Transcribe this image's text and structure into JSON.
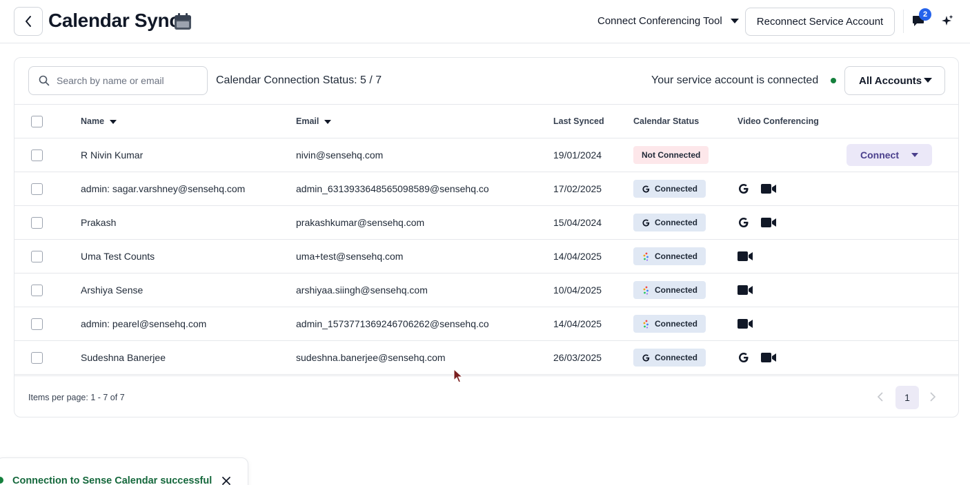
{
  "header": {
    "title": "Calendar Sync",
    "conferencing_tool_label": "Connect Conferencing Tool",
    "reconnect_label": "Reconnect Service Account",
    "notification_count": "2"
  },
  "toolbar": {
    "search_placeholder": "Search by name or email",
    "connection_status": "Calendar Connection Status: 5 / 7",
    "service_account_status": "Your service account is connected",
    "accounts_filter": "All Accounts"
  },
  "table": {
    "columns": {
      "name": "Name",
      "email": "Email",
      "last_synced": "Last Synced",
      "calendar_status": "Calendar Status",
      "video_conferencing": "Video Conferencing"
    },
    "connect_label": "Connect",
    "rows": [
      {
        "name": "R Nivin Kumar",
        "email": "nivin@sensehq.com",
        "last_synced": "19/01/2024",
        "status": "Not Connected",
        "provider": "none",
        "video": []
      },
      {
        "name": "admin: sagar.varshney@sensehq.com",
        "email": "admin_6313933648565098589@sensehq.co",
        "last_synced": "17/02/2025",
        "status": "Connected",
        "provider": "google",
        "video": [
          "google-icon",
          "video-camera-icon"
        ]
      },
      {
        "name": "Prakash",
        "email": "prakashkumar@sensehq.com",
        "last_synced": "15/04/2024",
        "status": "Connected",
        "provider": "google",
        "video": [
          "google-icon",
          "video-camera-icon"
        ]
      },
      {
        "name": "Uma Test Counts",
        "email": "uma+test@sensehq.com",
        "last_synced": "14/04/2025",
        "status": "Connected",
        "provider": "sense",
        "video": [
          "video-camera-icon"
        ]
      },
      {
        "name": "Arshiya Sense",
        "email": "arshiyaa.siingh@sensehq.com",
        "last_synced": "10/04/2025",
        "status": "Connected",
        "provider": "sense",
        "video": [
          "video-camera-icon"
        ]
      },
      {
        "name": "admin: pearel@sensehq.com",
        "email": "admin_1573771369246706262@sensehq.co",
        "last_synced": "14/04/2025",
        "status": "Connected",
        "provider": "sense",
        "video": [
          "video-camera-icon"
        ]
      },
      {
        "name": "Sudeshna Banerjee",
        "email": "sudeshna.banerjee@sensehq.com",
        "last_synced": "26/03/2025",
        "status": "Connected",
        "provider": "google",
        "video": [
          "google-icon",
          "video-camera-icon"
        ]
      }
    ]
  },
  "footer": {
    "items_text": "Items per page: 1 - 7 of 7",
    "current_page": "1"
  },
  "toast": {
    "message": "Connection to Sense Calendar successful"
  },
  "colors": {
    "connected_badge": "#e0e8f4",
    "not_connected_badge": "#fde7ea",
    "connect_button": "#ebe8f8",
    "success_green": "#15803d",
    "notification_blue": "#2563eb"
  }
}
